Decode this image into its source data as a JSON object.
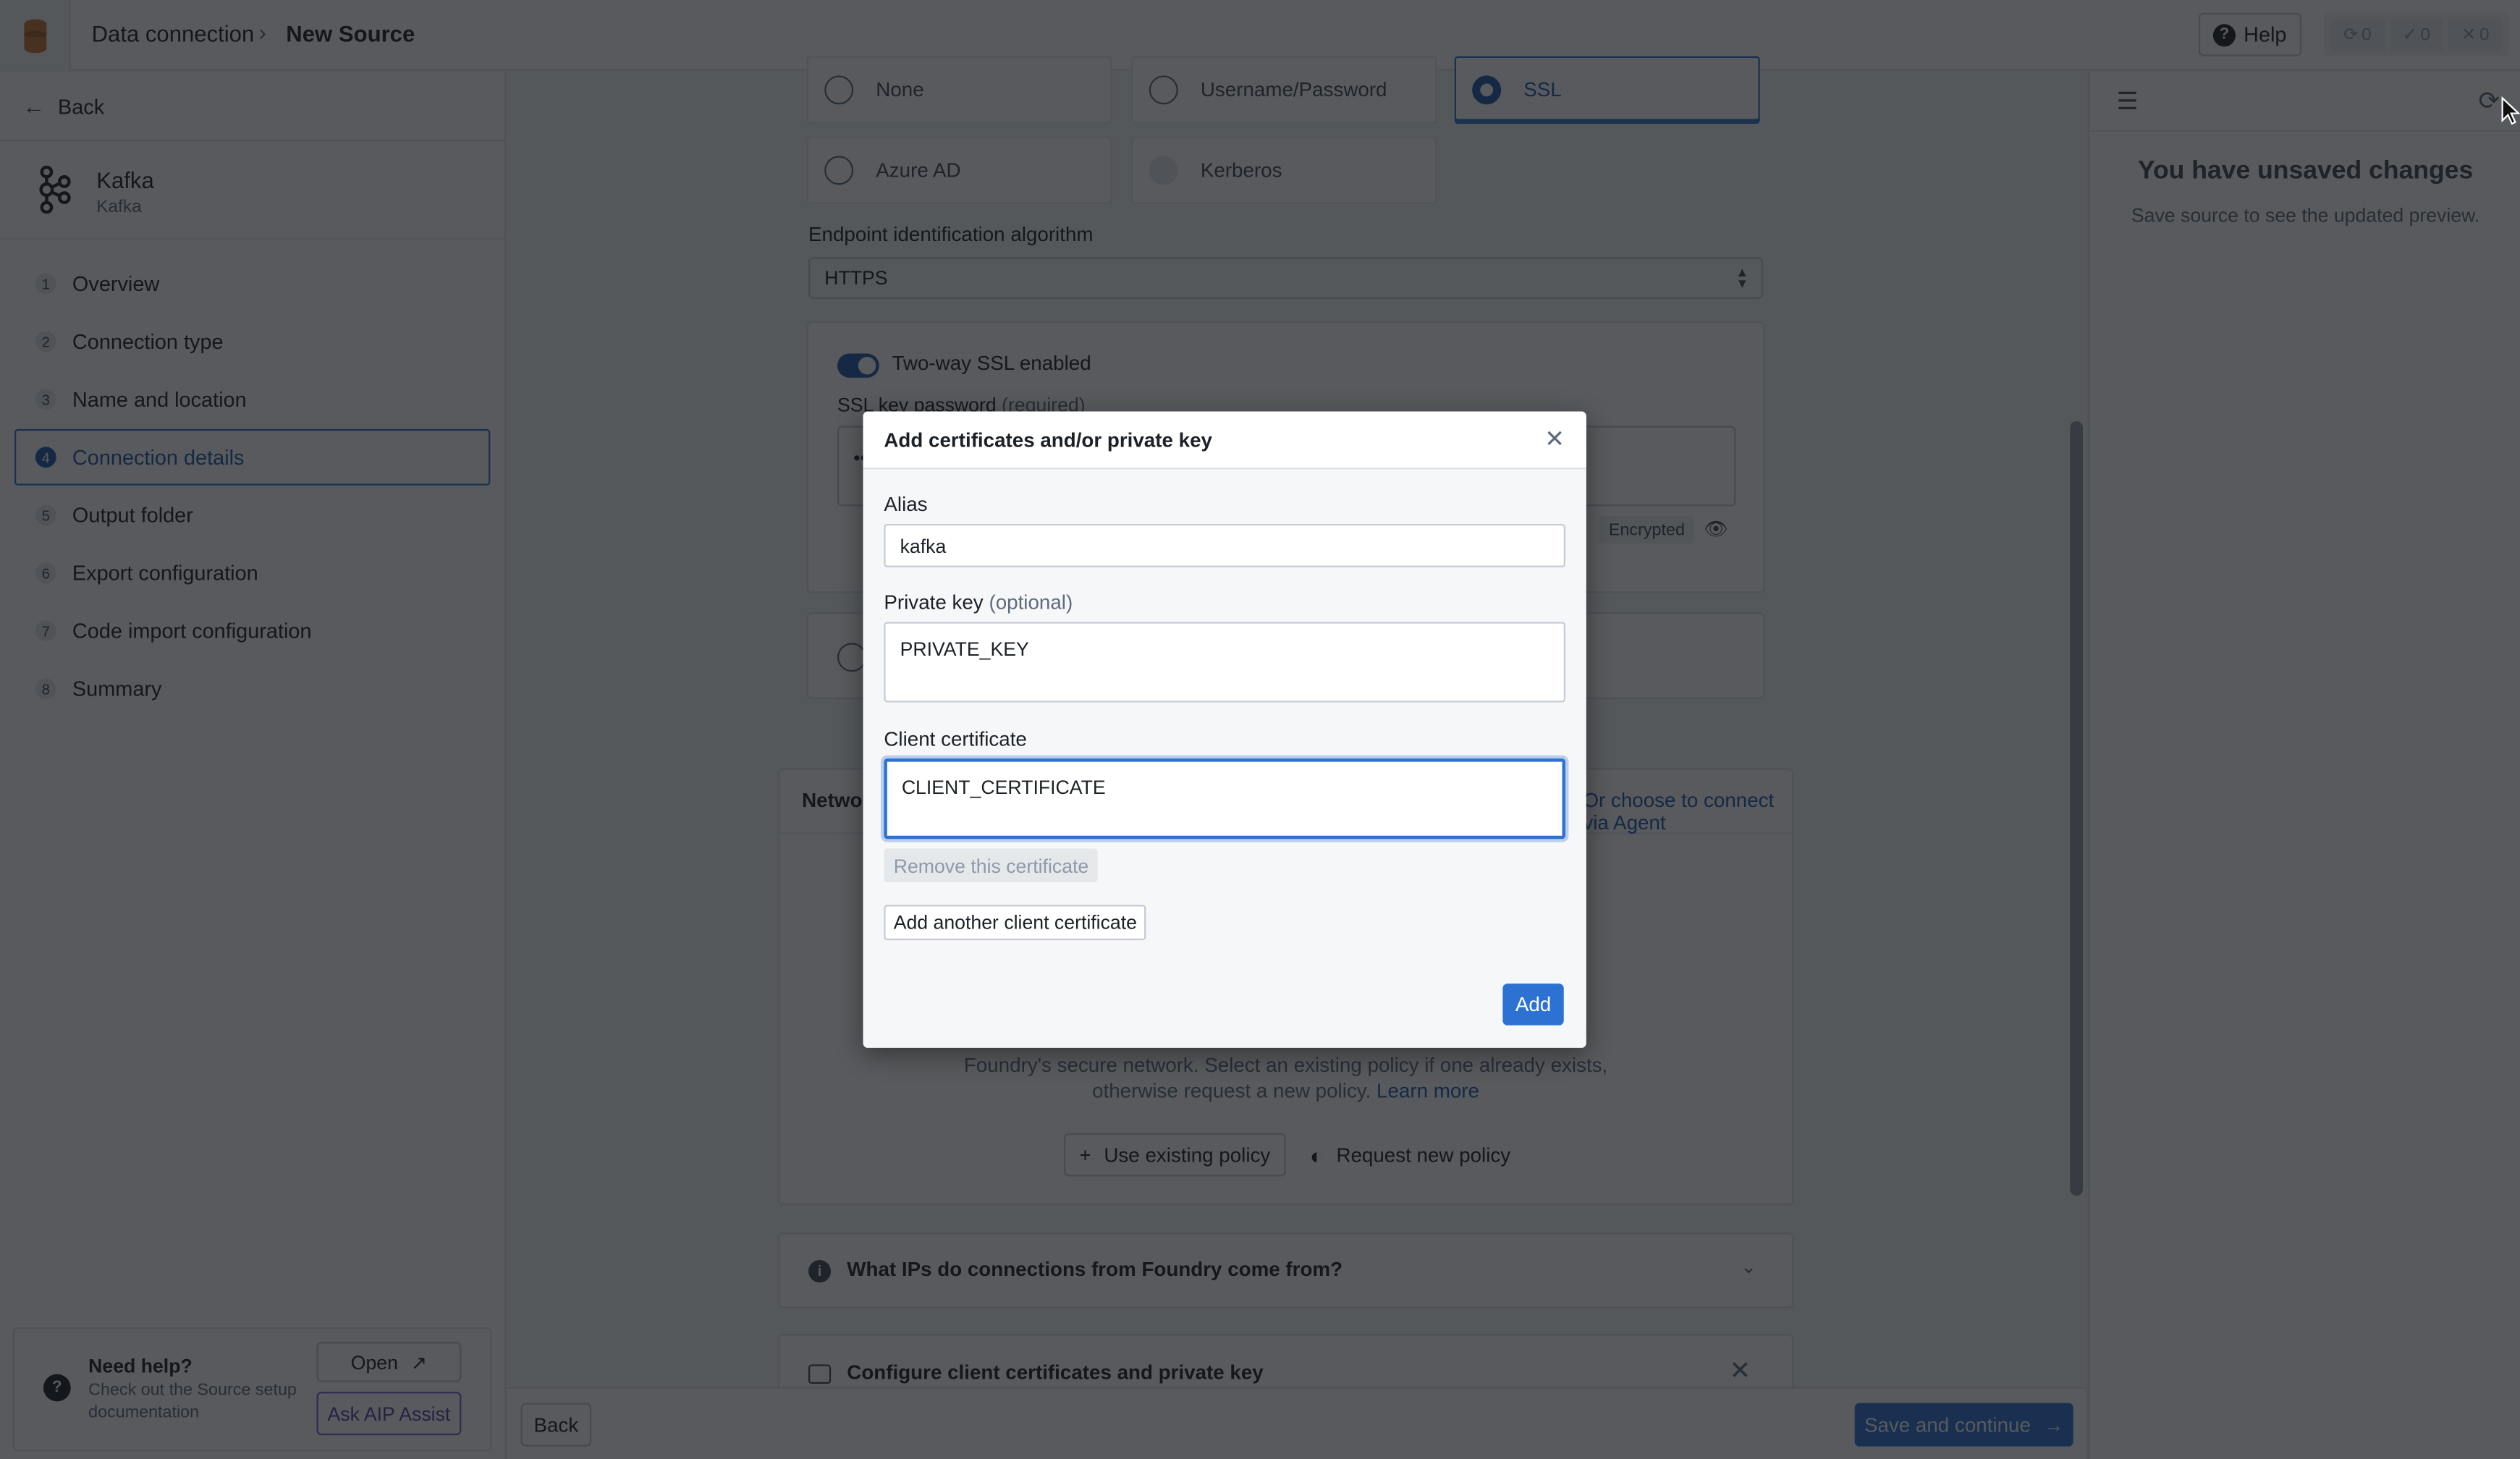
{
  "app": {
    "logo_icon": "database-icon",
    "breadcrumb": [
      "Data connection",
      "New Source"
    ],
    "help_label": "Help",
    "status_counts": [
      {
        "icon": "refresh-icon",
        "glyph": "⟳",
        "count": "0"
      },
      {
        "icon": "check-icon",
        "glyph": "✓",
        "count": "0"
      },
      {
        "icon": "x-icon",
        "glyph": "✕",
        "count": "0"
      }
    ]
  },
  "sidebar": {
    "back_label": "Back",
    "source_name": "Kafka",
    "source_type": "Kafka",
    "steps": [
      {
        "num": "1",
        "label": "Overview",
        "active": false
      },
      {
        "num": "2",
        "label": "Connection type",
        "active": false
      },
      {
        "num": "3",
        "label": "Name and location",
        "active": false
      },
      {
        "num": "4",
        "label": "Connection details",
        "active": true
      },
      {
        "num": "5",
        "label": "Output folder",
        "active": false
      },
      {
        "num": "6",
        "label": "Export configuration",
        "active": false
      },
      {
        "num": "7",
        "label": "Code import configuration",
        "active": false
      },
      {
        "num": "8",
        "label": "Summary",
        "active": false
      }
    ],
    "help": {
      "title": "Need help?",
      "description": "Check out the Source setup documentation",
      "open_label": "Open",
      "aip_label": "Ask AIP Assist"
    }
  },
  "main": {
    "auth_options": [
      {
        "label": "None",
        "state": "unchecked"
      },
      {
        "label": "Username/Password",
        "state": "unchecked"
      },
      {
        "label": "SSL",
        "state": "checked"
      },
      {
        "label": "Azure AD",
        "state": "unchecked"
      },
      {
        "label": "Kerberos",
        "state": "disabled"
      }
    ],
    "endpoint_label": "Endpoint identification algorithm",
    "endpoint_value": "HTTPS",
    "two_way_ssl_label": "Two-way SSL enabled",
    "two_way_ssl_enabled": true,
    "ssl_key_password_label": "SSL key password",
    "ssl_key_password_required": "(required)",
    "ssl_key_password_value": "••••••••",
    "encrypted_tag": "Encrypted",
    "network": {
      "title": "Network connectivity",
      "agent_link": "Or choose to connect via Agent",
      "description": "Foundry's secure network. Select an existing policy if one already exists, otherwise request a new policy.",
      "learn_more": "Learn more",
      "use_existing_label": "Use existing policy",
      "request_new_label": "Request new policy"
    },
    "ip_question": "What IPs do connections from Foundry come from?",
    "cert_section_title": "Configure client certificates and private key",
    "footer_back": "Back",
    "save_continue": "Save and continue"
  },
  "right_panel": {
    "title": "You have unsaved changes",
    "subtitle": "Save source to see the updated preview."
  },
  "modal": {
    "title": "Add certificates and/or private key",
    "alias_label": "Alias",
    "alias_value": "kafka",
    "private_key_label": "Private key",
    "private_key_optional": "(optional)",
    "private_key_value": "PRIVATE_KEY",
    "client_cert_label": "Client certificate",
    "client_cert_value": "CLIENT_CERTIFICATE",
    "remove_label": "Remove this certificate",
    "add_another_label": "Add another client certificate",
    "add_label": "Add"
  }
}
